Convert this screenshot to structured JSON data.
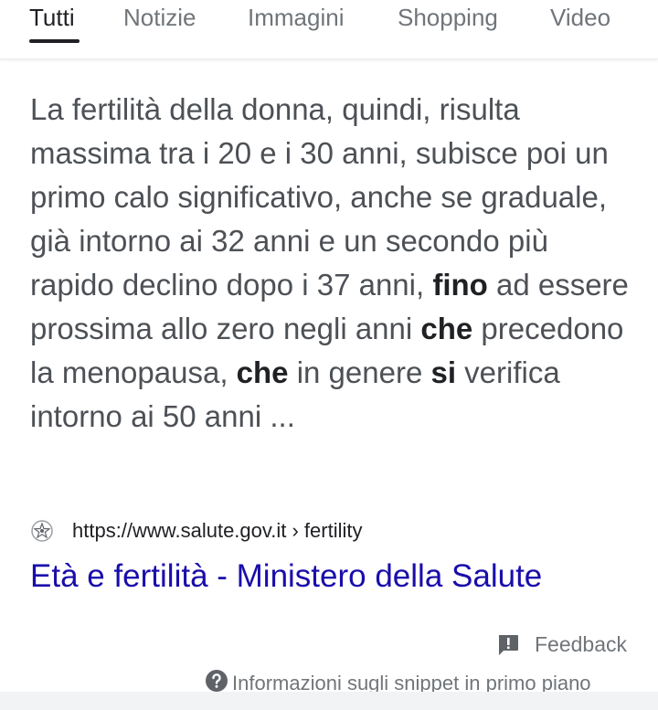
{
  "tabs": [
    {
      "label": "Tutti",
      "active": true
    },
    {
      "label": "Notizie",
      "active": false
    },
    {
      "label": "Immagini",
      "active": false
    },
    {
      "label": "Shopping",
      "active": false
    },
    {
      "label": "Video",
      "active": false
    }
  ],
  "snippet": {
    "segments": [
      {
        "text": "La fertilità della donna, quindi, risulta massima tra i 20 e i 30 anni, subisce poi un primo calo significativo, anche se graduale, già intorno ai 32 anni e un secondo più rapido declino dopo i 37 anni, ",
        "bold": false
      },
      {
        "text": "fino",
        "bold": true
      },
      {
        "text": " ad essere prossima allo zero negli anni ",
        "bold": false
      },
      {
        "text": "che",
        "bold": true
      },
      {
        "text": " precedono la menopausa, ",
        "bold": false
      },
      {
        "text": "che",
        "bold": true
      },
      {
        "text": " in genere ",
        "bold": false
      },
      {
        "text": "si",
        "bold": true
      },
      {
        "text": " verifica intorno ai 50 anni ...",
        "bold": false
      }
    ]
  },
  "result": {
    "favicon": "ministry-emblem-icon",
    "url": "https://www.salute.gov.it › fertility",
    "title": "Età e fertilità - Ministero della Salute"
  },
  "footer": {
    "feedback_icon": "feedback-icon",
    "feedback_label": "Feedback",
    "help_icon": "help-circle-icon",
    "info_label": "Informazioni sugli snippet in primo piano"
  },
  "colors": {
    "link": "#1a0dab",
    "text": "#4d5156",
    "muted": "#70757a",
    "dark": "#202124"
  }
}
